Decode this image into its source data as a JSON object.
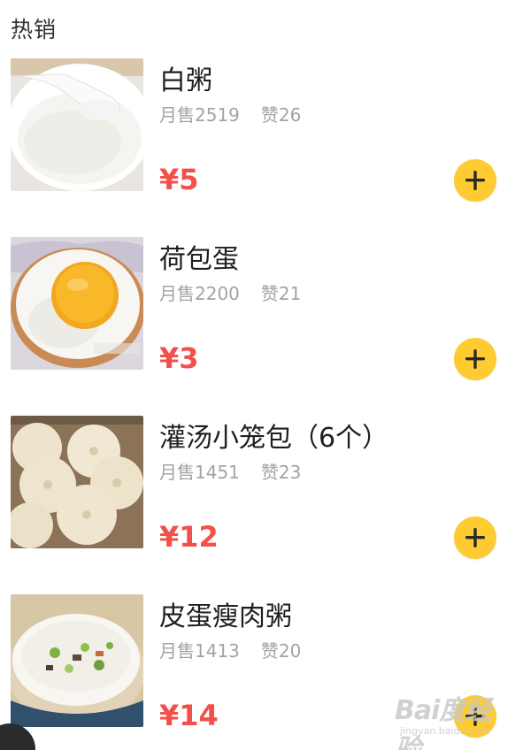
{
  "section": {
    "title": "热销"
  },
  "colors": {
    "price": "#f2504a",
    "add_button": "#fecb32",
    "muted": "#a3a3a3"
  },
  "items": [
    {
      "name": "白粥",
      "sales": "月售2519",
      "likes": "赞26",
      "price": "¥5",
      "image": "white-porridge-bowl"
    },
    {
      "name": "荷包蛋",
      "sales": "月售2200",
      "likes": "赞21",
      "price": "¥3",
      "image": "fried-egg"
    },
    {
      "name": "灌汤小笼包（6个）",
      "sales": "月售1451",
      "likes": "赞23",
      "price": "¥12",
      "image": "steamed-soup-dumplings"
    },
    {
      "name": "皮蛋瘦肉粥",
      "sales": "月售1413",
      "likes": "赞20",
      "price": "¥14",
      "image": "century-egg-porridge"
    }
  ],
  "add_button": {
    "icon": "plus-icon"
  },
  "watermark": {
    "text": "Bai度经验",
    "sub": "jingyan.baidu.com"
  }
}
